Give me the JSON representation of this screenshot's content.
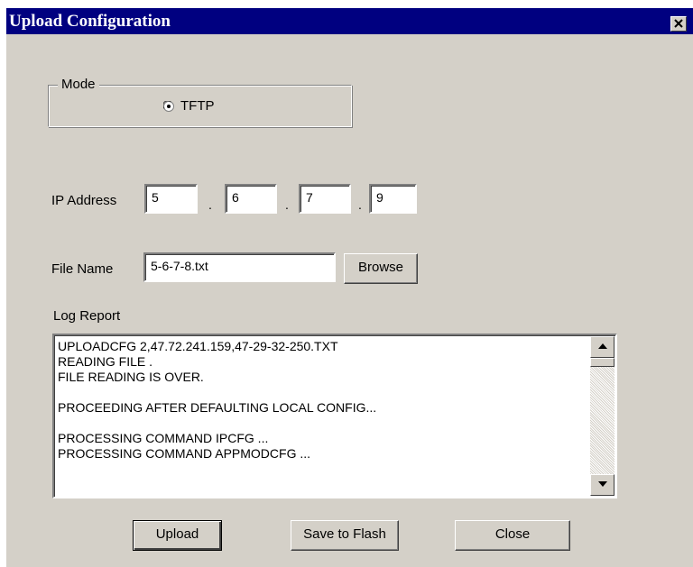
{
  "window": {
    "title": "Upload Configuration"
  },
  "mode": {
    "legend": "Mode",
    "option_label": "TFTP",
    "selected": true
  },
  "ip": {
    "label": "IP Address",
    "octets": [
      "5",
      "6",
      "7",
      "9"
    ],
    "separator": "."
  },
  "file": {
    "label": "File Name",
    "value": "5-6-7-8.txt",
    "browse_label": "Browse"
  },
  "log": {
    "label": "Log Report",
    "lines": [
      "UPLOADCFG 2,47.72.241.159,47-29-32-250.TXT",
      "READING FILE .",
      "FILE READING IS OVER.",
      "",
      "PROCEEDING AFTER DEFAULTING LOCAL CONFIG...",
      "",
      "PROCESSING COMMAND IPCFG ...",
      "PROCESSING COMMAND APPMODCFG ..."
    ]
  },
  "buttons": {
    "upload": "Upload",
    "save": "Save to Flash",
    "close": "Close"
  },
  "icons": {
    "close": "close-x-icon",
    "radio": "radio-selected-icon",
    "scroll_up": "arrow-up-icon",
    "scroll_down": "arrow-down-icon"
  }
}
